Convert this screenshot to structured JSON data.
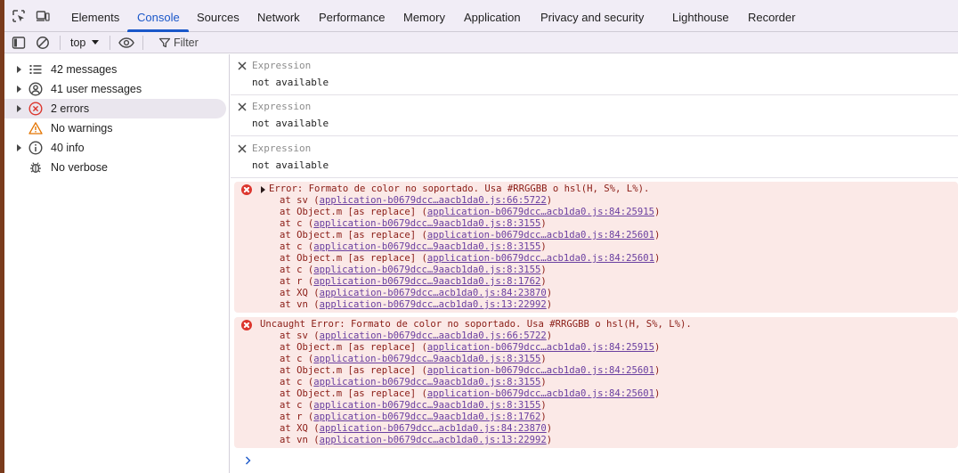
{
  "tabs": [
    {
      "label": "Elements",
      "active": false
    },
    {
      "label": "Console",
      "active": true
    },
    {
      "label": "Sources",
      "active": false
    },
    {
      "label": "Network",
      "active": false
    },
    {
      "label": "Performance",
      "active": false
    },
    {
      "label": "Memory",
      "active": false
    },
    {
      "label": "Application",
      "active": false
    },
    {
      "label": "Privacy and security",
      "active": false
    },
    {
      "label": "Lighthouse",
      "active": false
    },
    {
      "label": "Recorder",
      "active": false
    }
  ],
  "toolbar": {
    "context": "top",
    "filter_placeholder": "Filter"
  },
  "sidebar": {
    "items": [
      {
        "label": "42 messages",
        "icon": "list-icon",
        "expandable": true,
        "selected": false
      },
      {
        "label": "41 user messages",
        "icon": "user-icon",
        "expandable": true,
        "selected": false
      },
      {
        "label": "2 errors",
        "icon": "error-icon",
        "expandable": true,
        "selected": true
      },
      {
        "label": "No warnings",
        "icon": "warning-icon",
        "expandable": false,
        "selected": false
      },
      {
        "label": "40 info",
        "icon": "info-icon",
        "expandable": true,
        "selected": false
      },
      {
        "label": "No verbose",
        "icon": "bug-icon",
        "expandable": false,
        "selected": false
      }
    ]
  },
  "expressions": [
    {
      "name": "Expression",
      "value": "not available"
    },
    {
      "name": "Expression",
      "value": "not available"
    },
    {
      "name": "Expression",
      "value": "not available"
    }
  ],
  "errors": [
    {
      "message": "Error: Formato de color no soportado. Usa #RRGGBB o hsl(H, S%, L%).",
      "expandable": true,
      "frames": [
        {
          "fn": "sv",
          "link": "application-b0679dcc…aacb1da0.js:66:5722"
        },
        {
          "fn": "Object.m [as replace]",
          "link": "application-b0679dcc…acb1da0.js:84:25915"
        },
        {
          "fn": "c",
          "link": "application-b0679dcc…9aacb1da0.js:8:3155"
        },
        {
          "fn": "Object.m [as replace]",
          "link": "application-b0679dcc…acb1da0.js:84:25601"
        },
        {
          "fn": "c",
          "link": "application-b0679dcc…9aacb1da0.js:8:3155"
        },
        {
          "fn": "Object.m [as replace]",
          "link": "application-b0679dcc…acb1da0.js:84:25601"
        },
        {
          "fn": "c",
          "link": "application-b0679dcc…9aacb1da0.js:8:3155"
        },
        {
          "fn": "r",
          "link": "application-b0679dcc…9aacb1da0.js:8:1762"
        },
        {
          "fn": "XQ",
          "link": "application-b0679dcc…acb1da0.js:84:23870"
        },
        {
          "fn": "vn",
          "link": "application-b0679dcc…acb1da0.js:13:22992"
        }
      ]
    },
    {
      "message": "Uncaught Error: Formato de color no soportado. Usa #RRGGBB o hsl(H, S%, L%).",
      "expandable": false,
      "frames": [
        {
          "fn": "sv",
          "link": "application-b0679dcc…aacb1da0.js:66:5722"
        },
        {
          "fn": "Object.m [as replace]",
          "link": "application-b0679dcc…acb1da0.js:84:25915"
        },
        {
          "fn": "c",
          "link": "application-b0679dcc…9aacb1da0.js:8:3155"
        },
        {
          "fn": "Object.m [as replace]",
          "link": "application-b0679dcc…acb1da0.js:84:25601"
        },
        {
          "fn": "c",
          "link": "application-b0679dcc…9aacb1da0.js:8:3155"
        },
        {
          "fn": "Object.m [as replace]",
          "link": "application-b0679dcc…acb1da0.js:84:25601"
        },
        {
          "fn": "c",
          "link": "application-b0679dcc…9aacb1da0.js:8:3155"
        },
        {
          "fn": "r",
          "link": "application-b0679dcc…9aacb1da0.js:8:1762"
        },
        {
          "fn": "XQ",
          "link": "application-b0679dcc…acb1da0.js:84:23870"
        },
        {
          "fn": "vn",
          "link": "application-b0679dcc…acb1da0.js:13:22992"
        }
      ]
    }
  ],
  "colors": {
    "accent": "#1a57c9",
    "error_bg": "#fbe9e7",
    "error_text": "#8a1c15",
    "error_icon": "#dc362e",
    "link": "#6a3fa0",
    "warning": "#e37400"
  }
}
